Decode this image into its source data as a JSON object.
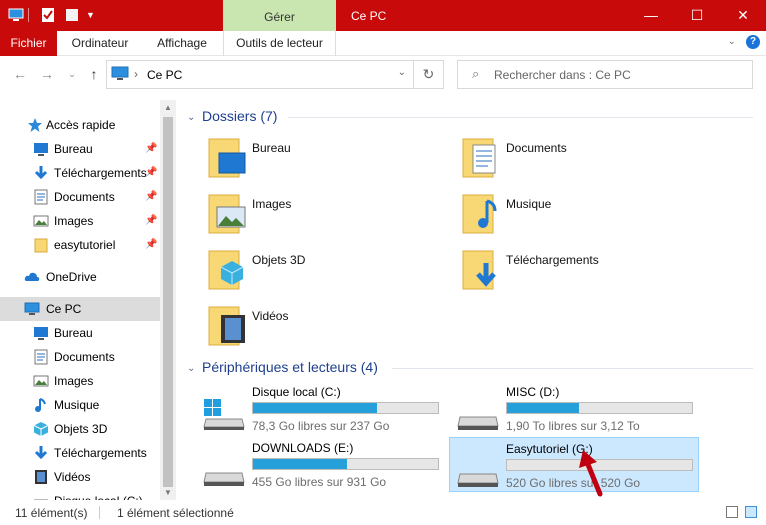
{
  "titlebar": {
    "context_tab": "Gérer",
    "title": "Ce PC",
    "accent": "#c80a0a",
    "context_color": "#c9e6b0"
  },
  "ribbon": {
    "tabs": [
      "Fichier",
      "Ordinateur",
      "Affichage",
      "Outils de lecteur"
    ]
  },
  "address": {
    "path": "Ce PC",
    "search_placeholder": "Rechercher dans : Ce PC"
  },
  "nav": {
    "items": [
      {
        "label": "Accès rapide",
        "icon": "star-icon"
      },
      {
        "label": "Bureau",
        "icon": "desktop-icon"
      },
      {
        "label": "Téléchargements",
        "icon": "download-icon"
      },
      {
        "label": "Documents",
        "icon": "document-icon"
      },
      {
        "label": "Images",
        "icon": "image-icon"
      },
      {
        "label": "easytutoriel",
        "icon": "folder-icon"
      },
      {
        "label": "OneDrive",
        "icon": "cloud-icon"
      },
      {
        "label": "Ce PC",
        "icon": "pc-icon"
      },
      {
        "label": "Bureau",
        "icon": "desktop-icon"
      },
      {
        "label": "Documents",
        "icon": "document-icon"
      },
      {
        "label": "Images",
        "icon": "image-icon"
      },
      {
        "label": "Musique",
        "icon": "music-icon"
      },
      {
        "label": "Objets 3D",
        "icon": "cube-icon"
      },
      {
        "label": "Téléchargements",
        "icon": "download-icon"
      },
      {
        "label": "Vidéos",
        "icon": "video-icon"
      },
      {
        "label": "Disque local (C:)",
        "icon": "drive-icon"
      }
    ]
  },
  "content": {
    "folders_header": "Dossiers (7)",
    "folders": [
      "Bureau",
      "Documents",
      "Images",
      "Musique",
      "Objets 3D",
      "Téléchargements",
      "Vidéos"
    ],
    "drives_header": "Périphériques et lecteurs (4)",
    "drives": [
      {
        "name": "Disque local (C:)",
        "free": "78,3 Go libres sur 237 Go",
        "used_fraction": 0.67
      },
      {
        "name": "MISC (D:)",
        "free": "1,90 To libres sur 3,12 To",
        "used_fraction": 0.39
      },
      {
        "name": "DOWNLOADS (E:)",
        "free": "455 Go libres sur 931 Go",
        "used_fraction": 0.51
      },
      {
        "name": "Easytutoriel (G:)",
        "free": "520 Go libres sur 520 Go",
        "used_fraction": 0.0
      }
    ]
  },
  "status": {
    "count": "11 élément(s)",
    "selection": "1 élément sélectionné"
  }
}
